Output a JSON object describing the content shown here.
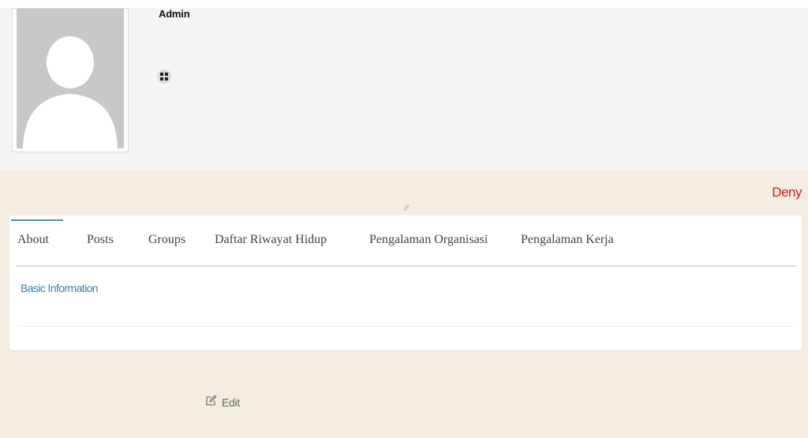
{
  "profile": {
    "name": "Admin",
    "avatar_icon": "user-silhouette-icon",
    "menu_icon": "grid-icon"
  },
  "cover": {
    "deny_label": "Deny",
    "slash_text": "//"
  },
  "tabs": [
    {
      "label": "About",
      "active": true
    },
    {
      "label": "Posts",
      "active": false
    },
    {
      "label": "Groups",
      "active": false
    },
    {
      "label": "Daftar Riwayat Hidup",
      "active": false
    },
    {
      "label": "Pengalaman Organisasi",
      "active": false
    },
    {
      "label": "Pengalaman Kerja",
      "active": false
    }
  ],
  "about": {
    "section_title": "Basic Information"
  },
  "edit": {
    "label": "Edit",
    "icon": "edit-icon"
  },
  "colors": {
    "accent": "#4a8fb8",
    "deny": "#cc2020",
    "cover_bg": "#f4ede1",
    "header_bg": "#f5f5f7"
  }
}
